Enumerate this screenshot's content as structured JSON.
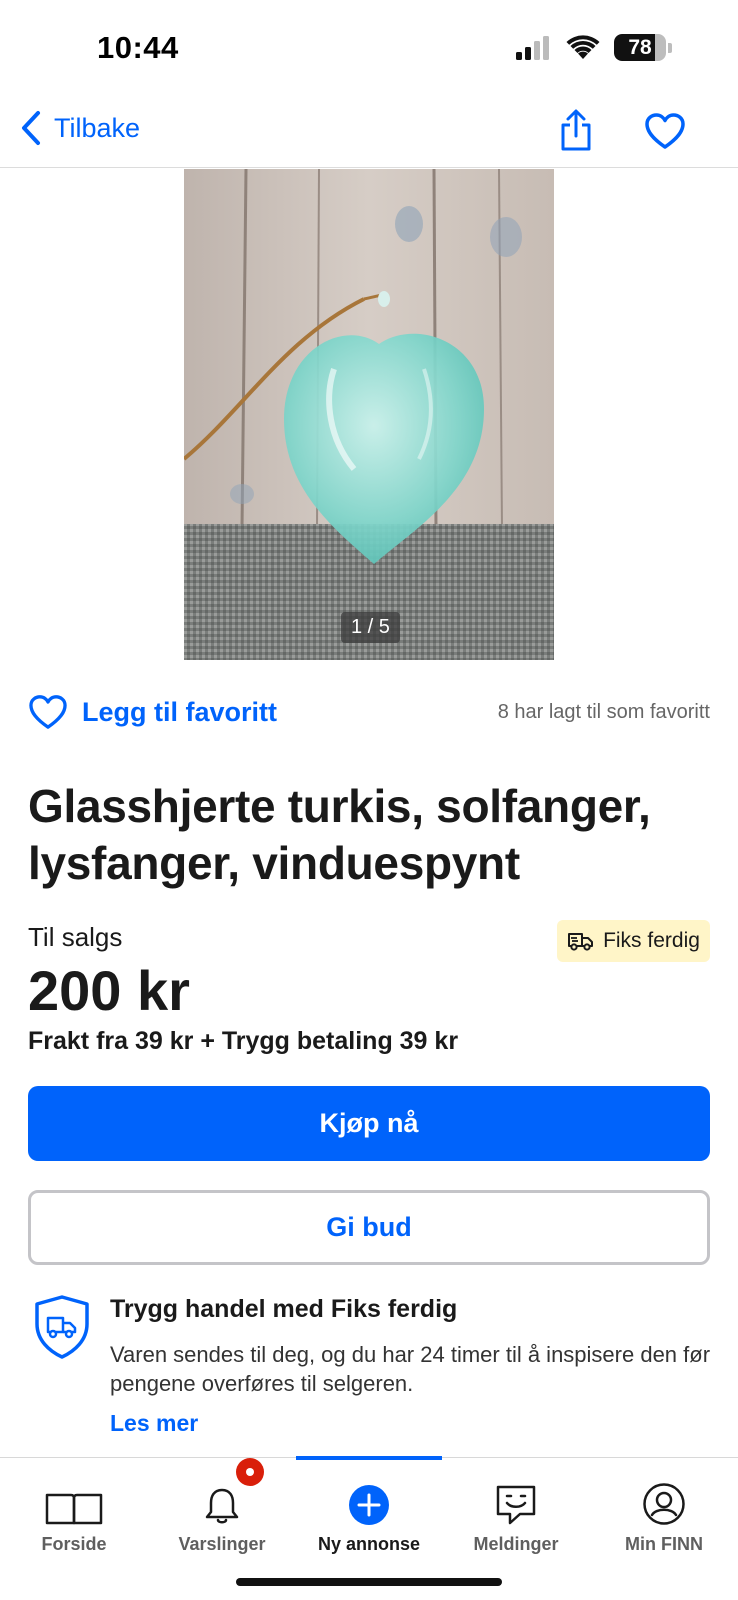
{
  "status_bar": {
    "time": "10:44",
    "battery_level": "78",
    "battery_fraction": 0.78
  },
  "nav": {
    "back_label": "Tilbake",
    "icons": [
      "chevron-left-icon",
      "share-icon",
      "heart-icon"
    ],
    "accent_color": "#0063fb"
  },
  "gallery": {
    "counter": "1 / 5"
  },
  "favorite": {
    "add_label": "Legg til favoritt",
    "count_text": "8 har lagt til som favoritt"
  },
  "listing": {
    "title": "Glasshjerte turkis, solfanger, lysfanger, vinduespynt",
    "sale_label": "Til salgs",
    "badge_label": "Fiks ferdig",
    "badge_color": "#fff5c8",
    "price": "200 kr",
    "shipping": "Frakt fra 39 kr + Trygg betaling 39 kr"
  },
  "actions": {
    "buy_label": "Kjøp nå",
    "bid_label": "Gi bud"
  },
  "safe_trade": {
    "title": "Trygg handel med Fiks ferdig",
    "body": "Varen sendes til deg, og du har 24 timer til å inspisere den før pengene overføres til selgeren.",
    "link": "Les mer"
  },
  "tab_bar": {
    "tabs": [
      {
        "label": "Forside",
        "icon": "book-icon"
      },
      {
        "label": "Varslinger",
        "icon": "bell-icon",
        "has_notification": true
      },
      {
        "label": "Ny annonse",
        "icon": "plus-circle-icon",
        "active": true
      },
      {
        "label": "Meldinger",
        "icon": "chat-icon"
      },
      {
        "label": "Min FINN",
        "icon": "profile-icon"
      }
    ],
    "notification_color": "#d91f0a"
  }
}
